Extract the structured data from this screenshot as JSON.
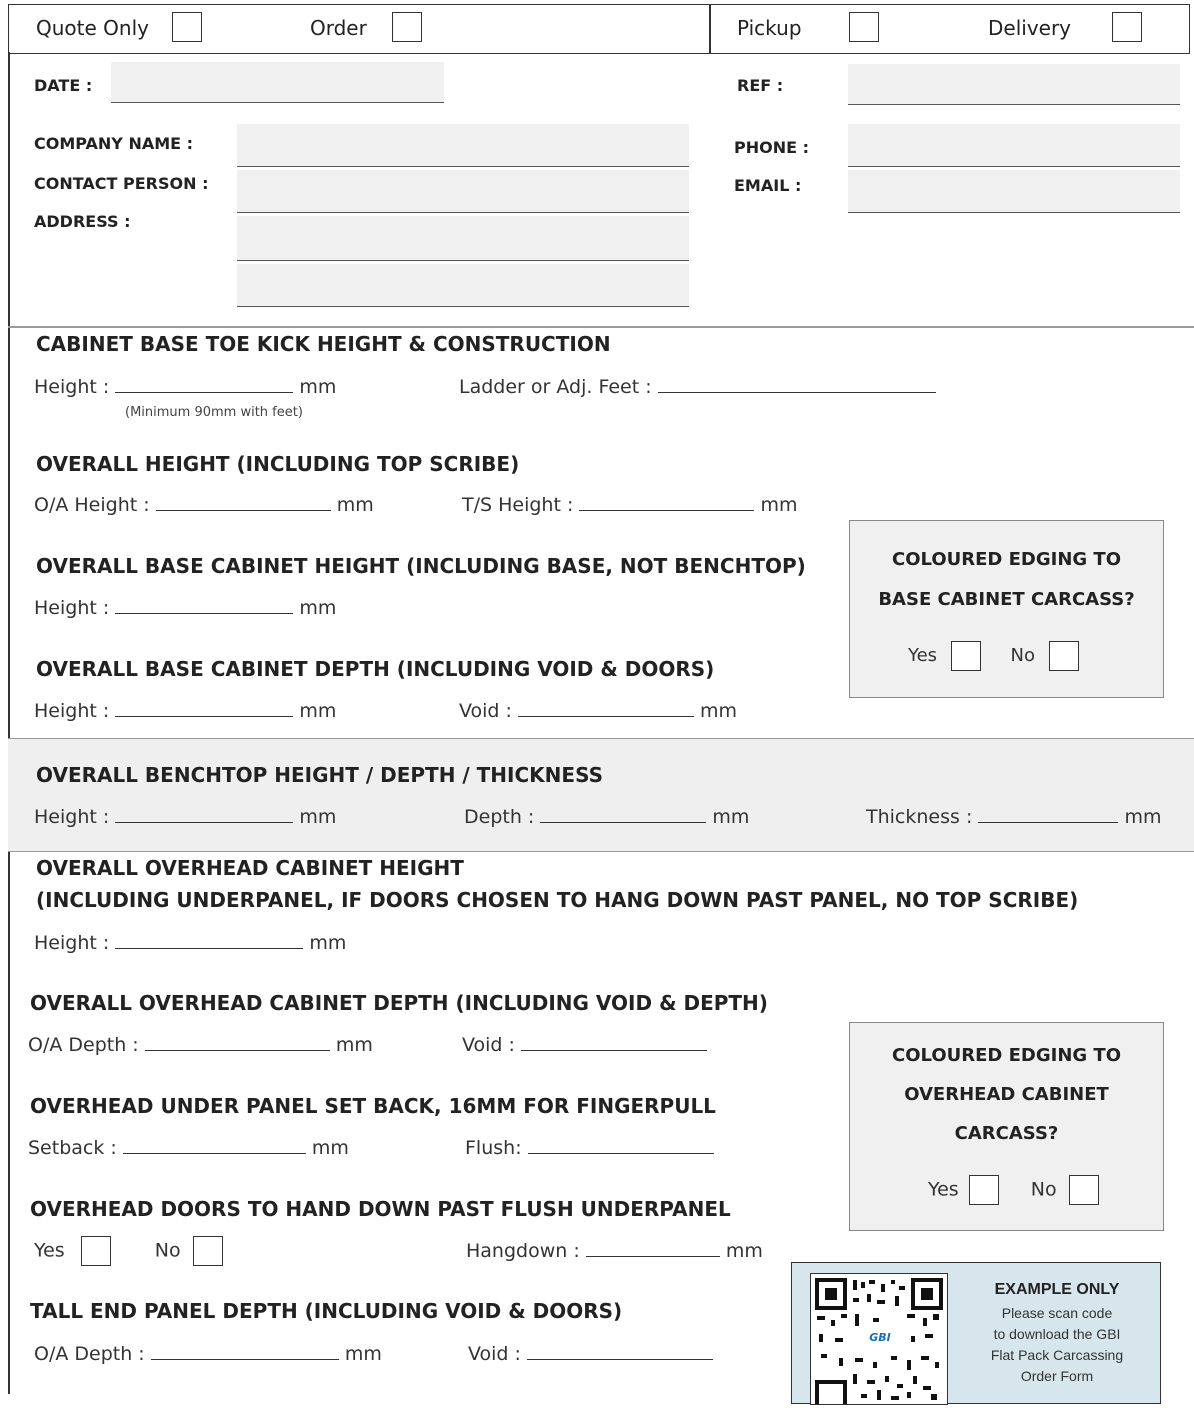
{
  "header": {
    "quote_only": "Quote Only",
    "order": "Order",
    "pickup": "Pickup",
    "delivery": "Delivery"
  },
  "details": {
    "date": "DATE :",
    "ref": "REF :",
    "company": "COMPANY NAME :",
    "phone": "PHONE :",
    "contact": "CONTACT PERSON :",
    "email": "EMAIL :",
    "address": "ADDRESS :"
  },
  "sections": {
    "toe_kick": {
      "title": "CABINET BASE TOE KICK HEIGHT & CONSTRUCTION",
      "height": "Height :",
      "mm": "mm",
      "ladder": "Ladder or Adj. Feet :",
      "note": "(Minimum 90mm with feet)"
    },
    "overall_height": {
      "title": "OVERALL HEIGHT  (INCLUDING TOP SCRIBE)",
      "oa_height": "O/A Height :",
      "mm": "mm",
      "ts_height": "T/S Height :"
    },
    "base_height": {
      "title": "OVERALL BASE CABINET HEIGHT (INCLUDING BASE, NOT BENCHTOP)",
      "height": "Height :",
      "mm": "mm"
    },
    "base_depth": {
      "title": "OVERALL BASE CABINET DEPTH (INCLUDING VOID & DOORS)",
      "height": "Height :",
      "mm": "mm",
      "void": "Void :"
    },
    "benchtop": {
      "title": "OVERALL BENCHTOP HEIGHT / DEPTH / THICKNESS",
      "height": "Height :",
      "mm": "mm",
      "depth": "Depth :",
      "thickness": "Thickness :"
    },
    "overhead_height": {
      "title1": "OVERALL OVERHEAD CABINET HEIGHT",
      "title2": "(INCLUDING UNDERPANEL, IF DOORS CHOSEN TO HANG DOWN PAST PANEL, NO TOP SCRIBE)",
      "height": "Height :",
      "mm": "mm"
    },
    "overhead_depth": {
      "title": "OVERALL OVERHEAD CABINET DEPTH (INCLUDING VOID & DEPTH)",
      "oa_depth": "O/A Depth :",
      "mm": "mm",
      "void": "Void :"
    },
    "underpanel": {
      "title": "OVERHEAD UNDER PANEL SET BACK, 16MM FOR FINGERPULL",
      "setback": "Setback :",
      "mm": "mm",
      "flush": "Flush:"
    },
    "hangdown": {
      "title": "OVERHEAD DOORS TO HAND DOWN PAST FLUSH UNDERPANEL",
      "yes": "Yes",
      "no": "No",
      "hangdown": "Hangdown :",
      "mm": "mm"
    },
    "tall_end": {
      "title": "TALL END PANEL DEPTH (INCLUDING VOID & DOORS)",
      "oa_depth": "O/A Depth :",
      "mm": "mm",
      "void": "Void :"
    }
  },
  "edging_base": {
    "line1": "COLOURED EDGING TO",
    "line2": "BASE CABINET CARCASS?",
    "yes": "Yes",
    "no": "No"
  },
  "edging_overhead": {
    "line1": "COLOURED EDGING TO",
    "line2": "OVERHEAD CABINET",
    "line3": "CARCASS?",
    "yes": "Yes",
    "no": "No"
  },
  "example": {
    "title": "EXAMPLE ONLY",
    "line1": "Please scan code",
    "line2": "to download the GBI",
    "line3": "Flat Pack Carcassing",
    "line4": "Order Form",
    "qr_logo": "GBI"
  }
}
